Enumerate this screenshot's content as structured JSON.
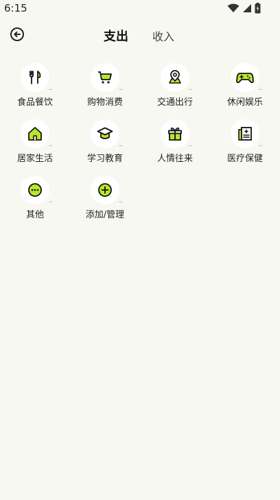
{
  "status": {
    "time": "6:15"
  },
  "header": {
    "tab_expense": "支出",
    "tab_income": "收入"
  },
  "categories": [
    {
      "label": "食品餐饮",
      "icon": "fork-knife-icon"
    },
    {
      "label": "购物消费",
      "icon": "shopping-cart-icon"
    },
    {
      "label": "交通出行",
      "icon": "map-pin-icon"
    },
    {
      "label": "休闲娱乐",
      "icon": "gamepad-icon"
    },
    {
      "label": "居家生活",
      "icon": "home-icon"
    },
    {
      "label": "学习教育",
      "icon": "graduation-cap-icon"
    },
    {
      "label": "人情往来",
      "icon": "gift-icon"
    },
    {
      "label": "医疗保健",
      "icon": "medical-record-icon"
    },
    {
      "label": "其他",
      "icon": "more-icon"
    },
    {
      "label": "添加/管理",
      "icon": "plus-icon"
    }
  ],
  "more_glyph": "...",
  "colors": {
    "accent": "#b8e82a",
    "background": "#f8f8f3"
  }
}
